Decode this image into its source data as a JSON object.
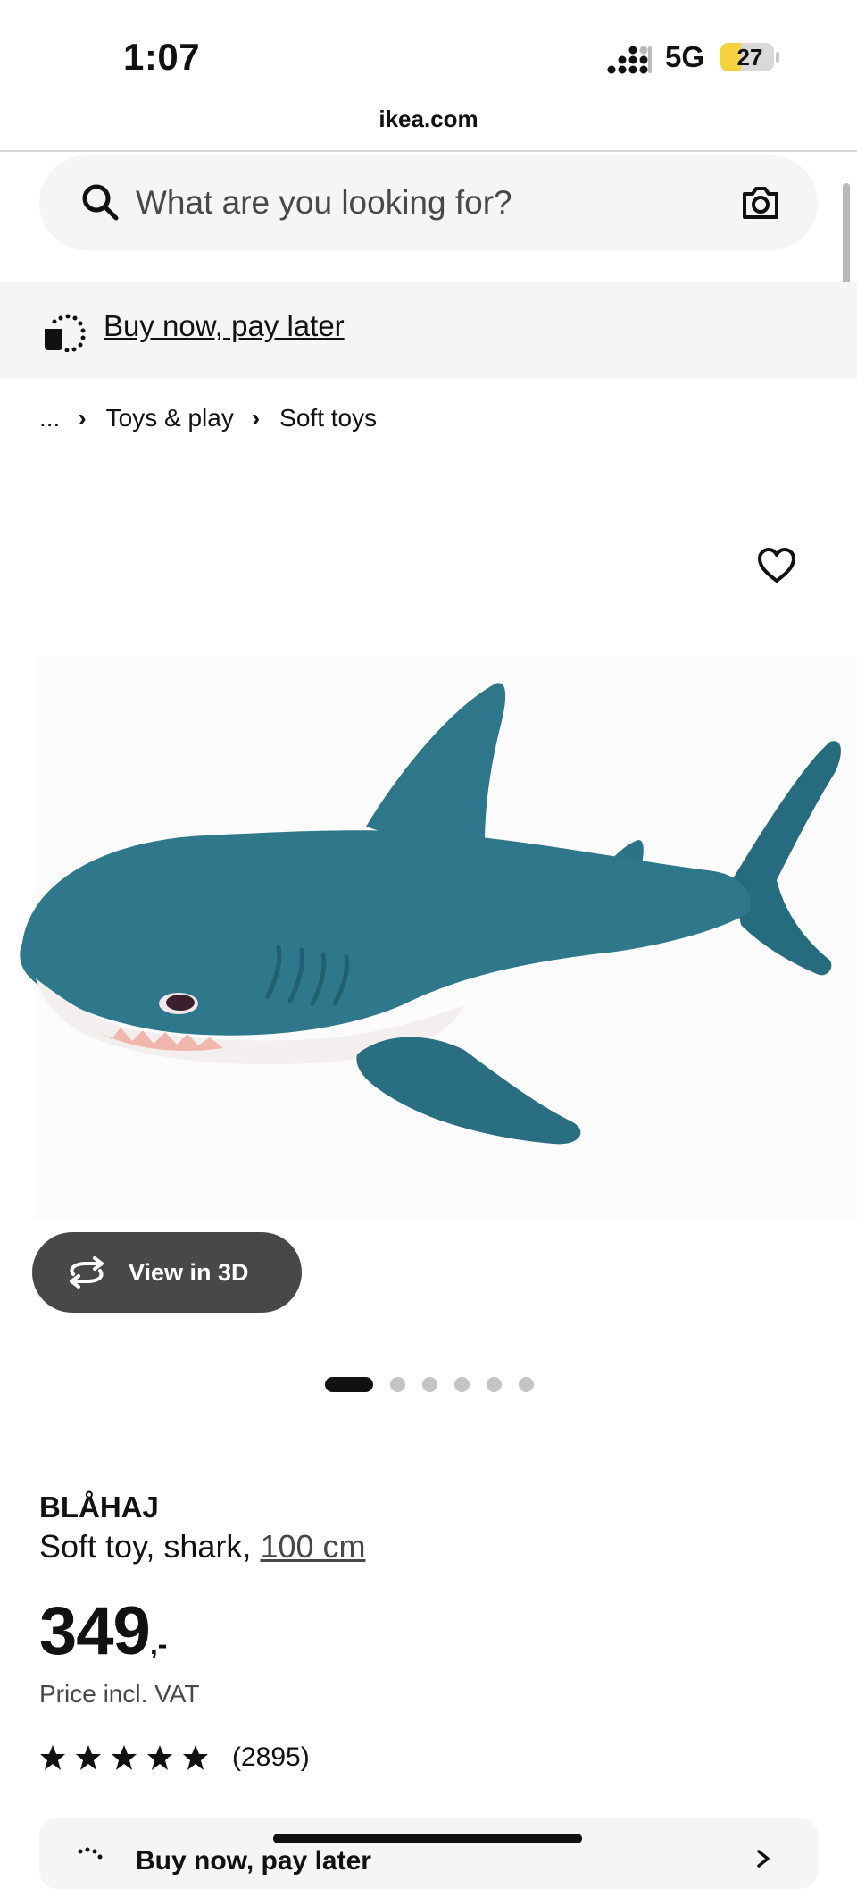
{
  "status_bar": {
    "time": "1:07",
    "network": "5G",
    "battery": "27"
  },
  "browser": {
    "url": "ikea.com"
  },
  "search": {
    "placeholder": "What are you looking for?"
  },
  "promo": {
    "label": "Buy now, pay later"
  },
  "breadcrumb": [
    {
      "label": "..."
    },
    {
      "label": "Toys & play"
    },
    {
      "label": "Soft toys"
    }
  ],
  "gallery": {
    "view_3d_label": "View in 3D",
    "image_count": 6,
    "active_index": 0
  },
  "product": {
    "name": "BLÅHAJ",
    "description": "Soft toy, shark, ",
    "size": "100 cm",
    "price": "349",
    "price_suffix": ",-",
    "price_note": "Price incl. VAT",
    "rating_stars": 5,
    "review_count": "(2895)"
  },
  "bottom_card": {
    "label": "Buy now, pay later"
  },
  "icons": [
    "search-icon",
    "camera-icon",
    "payment-icon",
    "chevron-right-icon",
    "heart-icon",
    "rotate-icon",
    "star-icon",
    "signal-icon",
    "battery-icon"
  ],
  "colors": {
    "button_dark": "#484848",
    "surface": "#f5f5f5",
    "battery_yellow": "#f6d23c",
    "shark_blue": "#2c7284"
  }
}
